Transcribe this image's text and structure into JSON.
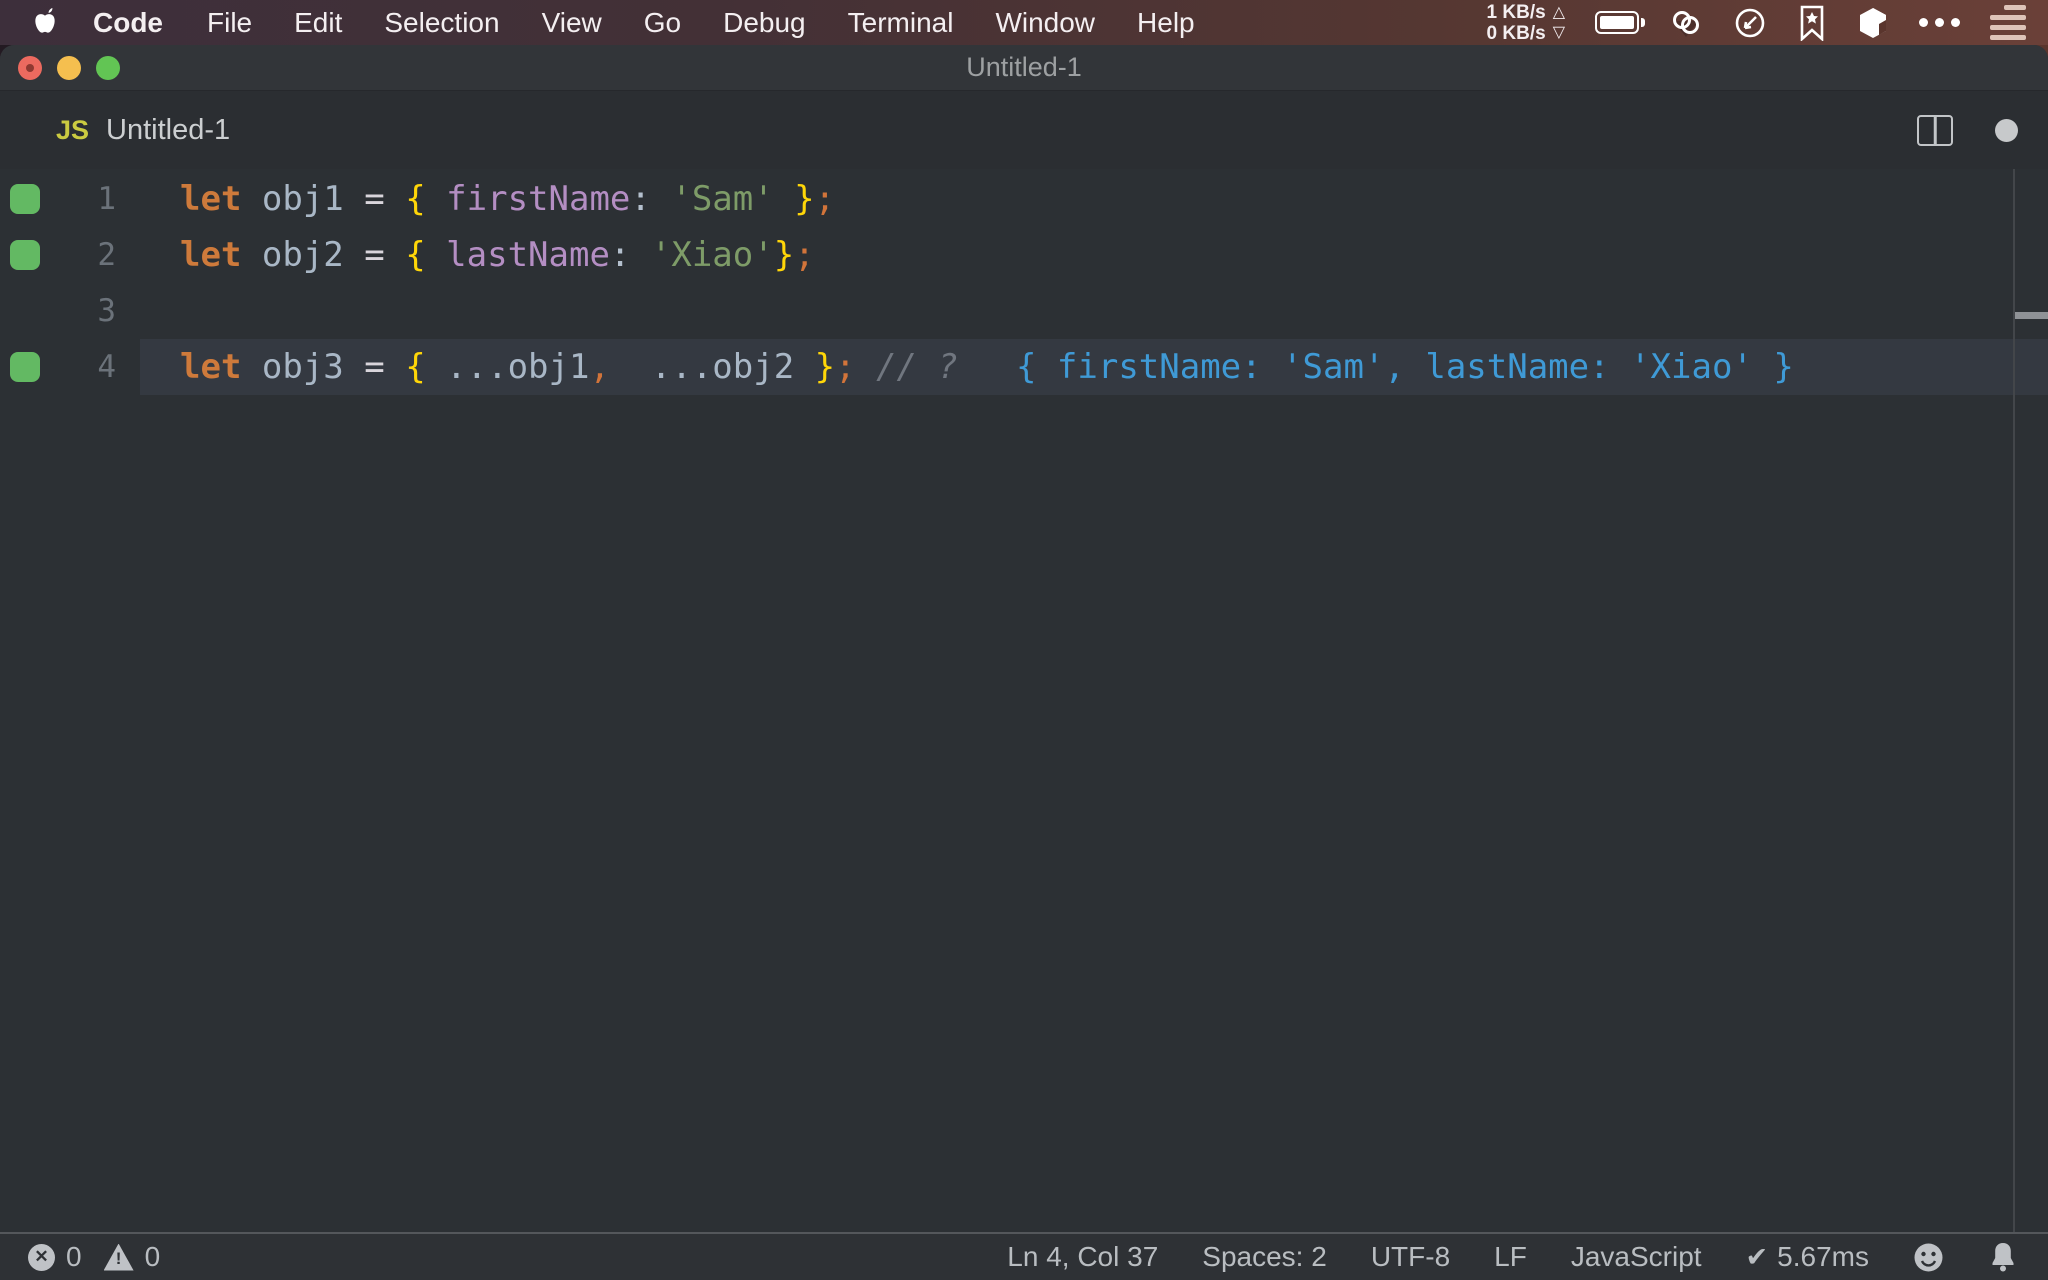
{
  "menu_bar": {
    "items": [
      "Code",
      "File",
      "Edit",
      "Selection",
      "View",
      "Go",
      "Debug",
      "Terminal",
      "Window",
      "Help"
    ],
    "network_up": "1 KB/s",
    "network_down": "0 KB/s",
    "up_symbol": "△",
    "down_symbol": "▽"
  },
  "window": {
    "title": "Untitled-1"
  },
  "tab": {
    "icon_label": "JS",
    "label": "Untitled-1"
  },
  "editor": {
    "lines": [
      {
        "number": "1",
        "marker": true,
        "current": false,
        "tokens": [
          {
            "t": "let ",
            "s": "kw"
          },
          {
            "t": "obj1 ",
            "s": "var"
          },
          {
            "t": "= ",
            "s": "op"
          },
          {
            "t": "{ ",
            "s": "brace"
          },
          {
            "t": "firstName",
            "s": "prop"
          },
          {
            "t": ": ",
            "s": "colon"
          },
          {
            "t": "'Sam'",
            "s": "str"
          },
          {
            "t": " }",
            "s": "brace"
          },
          {
            "t": ";",
            "s": "punct"
          }
        ]
      },
      {
        "number": "2",
        "marker": true,
        "current": false,
        "tokens": [
          {
            "t": "let ",
            "s": "kw"
          },
          {
            "t": "obj2 ",
            "s": "var"
          },
          {
            "t": "= ",
            "s": "op"
          },
          {
            "t": "{ ",
            "s": "brace"
          },
          {
            "t": "lastName",
            "s": "prop"
          },
          {
            "t": ": ",
            "s": "colon"
          },
          {
            "t": "'Xiao'",
            "s": "str"
          },
          {
            "t": "}",
            "s": "brace"
          },
          {
            "t": ";",
            "s": "punct"
          }
        ]
      },
      {
        "number": "3",
        "marker": false,
        "current": false,
        "tokens": []
      },
      {
        "number": "4",
        "marker": true,
        "current": true,
        "tokens": [
          {
            "t": "let ",
            "s": "kw"
          },
          {
            "t": "obj3 ",
            "s": "var"
          },
          {
            "t": "= ",
            "s": "op"
          },
          {
            "t": "{ ",
            "s": "brace"
          },
          {
            "t": "...obj1",
            "s": "var"
          },
          {
            "t": ", ",
            "s": "punct"
          },
          {
            "t": " ...obj2 ",
            "s": "var"
          },
          {
            "t": "}",
            "s": "brace"
          },
          {
            "t": "; ",
            "s": "punct"
          },
          {
            "t": "// ?",
            "s": "comment"
          },
          {
            "t": "{ firstName: 'Sam', lastName: 'Xiao' }",
            "s": "quokka"
          }
        ]
      }
    ]
  },
  "status_bar": {
    "errors": "0",
    "warnings": "0",
    "error_glyph": "✕",
    "warning_glyph": "!",
    "cursor_position": "Ln 4, Col 37",
    "indentation": "Spaces: 2",
    "encoding": "UTF-8",
    "eol": "LF",
    "language": "JavaScript",
    "check_glyph": "✔",
    "quokka_time": "5.67ms"
  },
  "colors": {
    "coverage-green": "#63b963",
    "quokka-blue": "#3f9ad6",
    "js-icon-yellow": "#cbcb41",
    "keyword-orange": "#ce7a3b",
    "brace-gold": "#ffd608",
    "property-purple": "#b48ec3",
    "string-green": "#7e9c68",
    "punct-orange": "#d2743a",
    "variable-gray": "#a9b7c6",
    "traffic-red": "#ec6a5f",
    "traffic-yellow": "#f5bf4f",
    "traffic-green": "#62c554"
  }
}
